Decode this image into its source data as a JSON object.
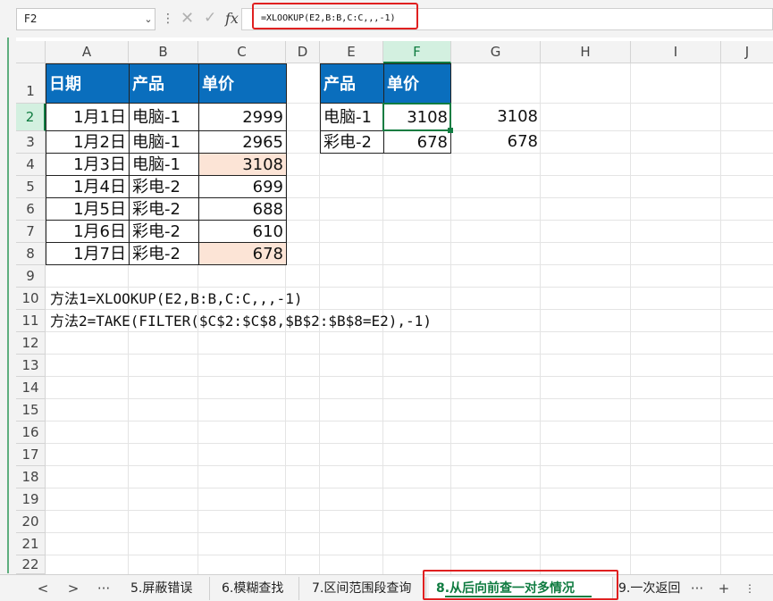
{
  "formula_bar": {
    "name_box": "F2",
    "formula": "=XLOOKUP(E2,B:B,C:C,,,-1)",
    "fx_label": "fx"
  },
  "columns": [
    "A",
    "B",
    "C",
    "D",
    "E",
    "F",
    "G",
    "H",
    "I",
    "J"
  ],
  "rows": [
    "1",
    "2",
    "3",
    "4",
    "5",
    "6",
    "7",
    "8",
    "9",
    "10",
    "11",
    "12",
    "13",
    "14",
    "15",
    "16",
    "17",
    "18",
    "19",
    "20",
    "21",
    "22"
  ],
  "table_left": {
    "headers": [
      "日期",
      "产品",
      "单价"
    ],
    "rows": [
      [
        "1月1日",
        "电脑-1",
        "2999"
      ],
      [
        "1月2日",
        "电脑-1",
        "2965"
      ],
      [
        "1月3日",
        "电脑-1",
        "3108"
      ],
      [
        "1月4日",
        "彩电-2",
        "699"
      ],
      [
        "1月5日",
        "彩电-2",
        "688"
      ],
      [
        "1月6日",
        "彩电-2",
        "610"
      ],
      [
        "1月7日",
        "彩电-2",
        "678"
      ]
    ]
  },
  "table_right": {
    "headers": [
      "产品",
      "单价"
    ],
    "rows": [
      [
        "电脑-1",
        "3108"
      ],
      [
        "彩电-2",
        "678"
      ]
    ]
  },
  "column_g": [
    "3108",
    "678"
  ],
  "notes": [
    "方法1=XLOOKUP(E2,B:B,C:C,,,-1)",
    "方法2=TAKE(FILTER($C$2:$C$8,$B$2:$B$8=E2),-1)"
  ],
  "sheet_tabs": {
    "tabs": [
      "5.屏蔽错误",
      "6.模糊查找",
      "7.区间范围段查询",
      "8.从后向前查一对多情况",
      "9.一次返回"
    ],
    "active_index": 3,
    "prev": "<",
    "next": ">",
    "more": "···",
    "more_right": "···",
    "add": "+"
  },
  "colors": {
    "header_fill": "#0a6ebd",
    "highlight_fill": "#fce4d6",
    "accent": "#107c41",
    "annotation": "#e02020"
  }
}
